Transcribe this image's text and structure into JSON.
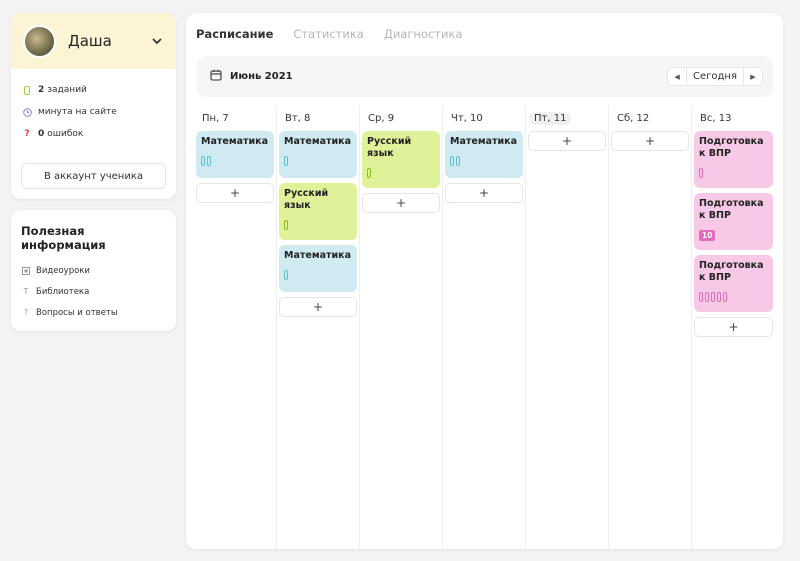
{
  "profile": {
    "name": "Даша",
    "stats": [
      {
        "icon": "task-icon",
        "value": "2",
        "label": "заданий",
        "color": "#9bd34a"
      },
      {
        "icon": "clock-icon",
        "value": "",
        "label": "минута на сайте",
        "color": "#8d7bdc"
      },
      {
        "icon": "question-icon",
        "value": "0",
        "label": "ошибок",
        "color": "#e23b3b"
      }
    ],
    "student_button": "В аккаунт ученика"
  },
  "info": {
    "title": "Полезная информация",
    "items": [
      {
        "icon": "video-icon",
        "label": "Видеоуроки"
      },
      {
        "icon": "text-icon",
        "label": "Библиотека"
      },
      {
        "icon": "help-icon",
        "label": "Вопросы и ответы"
      }
    ]
  },
  "tabs": [
    {
      "label": "Расписание",
      "active": true
    },
    {
      "label": "Статистика",
      "active": false
    },
    {
      "label": "Диагностика",
      "active": false
    }
  ],
  "datebar": {
    "month": "Июнь 2021",
    "today_label": "Сегодня",
    "prev_arrow": "◀",
    "next_arrow": "▶"
  },
  "add_label": "+",
  "days": [
    {
      "label": "Пн, 7",
      "today": false,
      "lessons": [
        {
          "kind": "math",
          "title": "Математика",
          "marks": 2
        }
      ]
    },
    {
      "label": "Вт, 8",
      "today": false,
      "lessons": [
        {
          "kind": "math",
          "title": "Математика",
          "marks": 1
        },
        {
          "kind": "rus",
          "title": "Русский язык",
          "marks": 1
        },
        {
          "kind": "math",
          "title": "Математика",
          "marks": 1
        }
      ]
    },
    {
      "label": "Ср, 9",
      "today": false,
      "lessons": [
        {
          "kind": "rus",
          "title": "Русский язык",
          "marks": 1
        }
      ]
    },
    {
      "label": "Чт, 10",
      "today": false,
      "lessons": [
        {
          "kind": "math",
          "title": "Математика",
          "marks": 2
        }
      ]
    },
    {
      "label": "Пт, 11",
      "today": true,
      "lessons": []
    },
    {
      "label": "Сб, 12",
      "today": false,
      "lessons": []
    },
    {
      "label": "Вс, 13",
      "today": false,
      "lessons": [
        {
          "kind": "vpr",
          "title": "Подготовка к ВПР",
          "marks": 1
        },
        {
          "kind": "vpr",
          "title": "Подготовка к ВПР",
          "grade": "10"
        },
        {
          "kind": "vpr",
          "title": "Подготовка к ВПР",
          "marks": 5
        }
      ]
    }
  ]
}
